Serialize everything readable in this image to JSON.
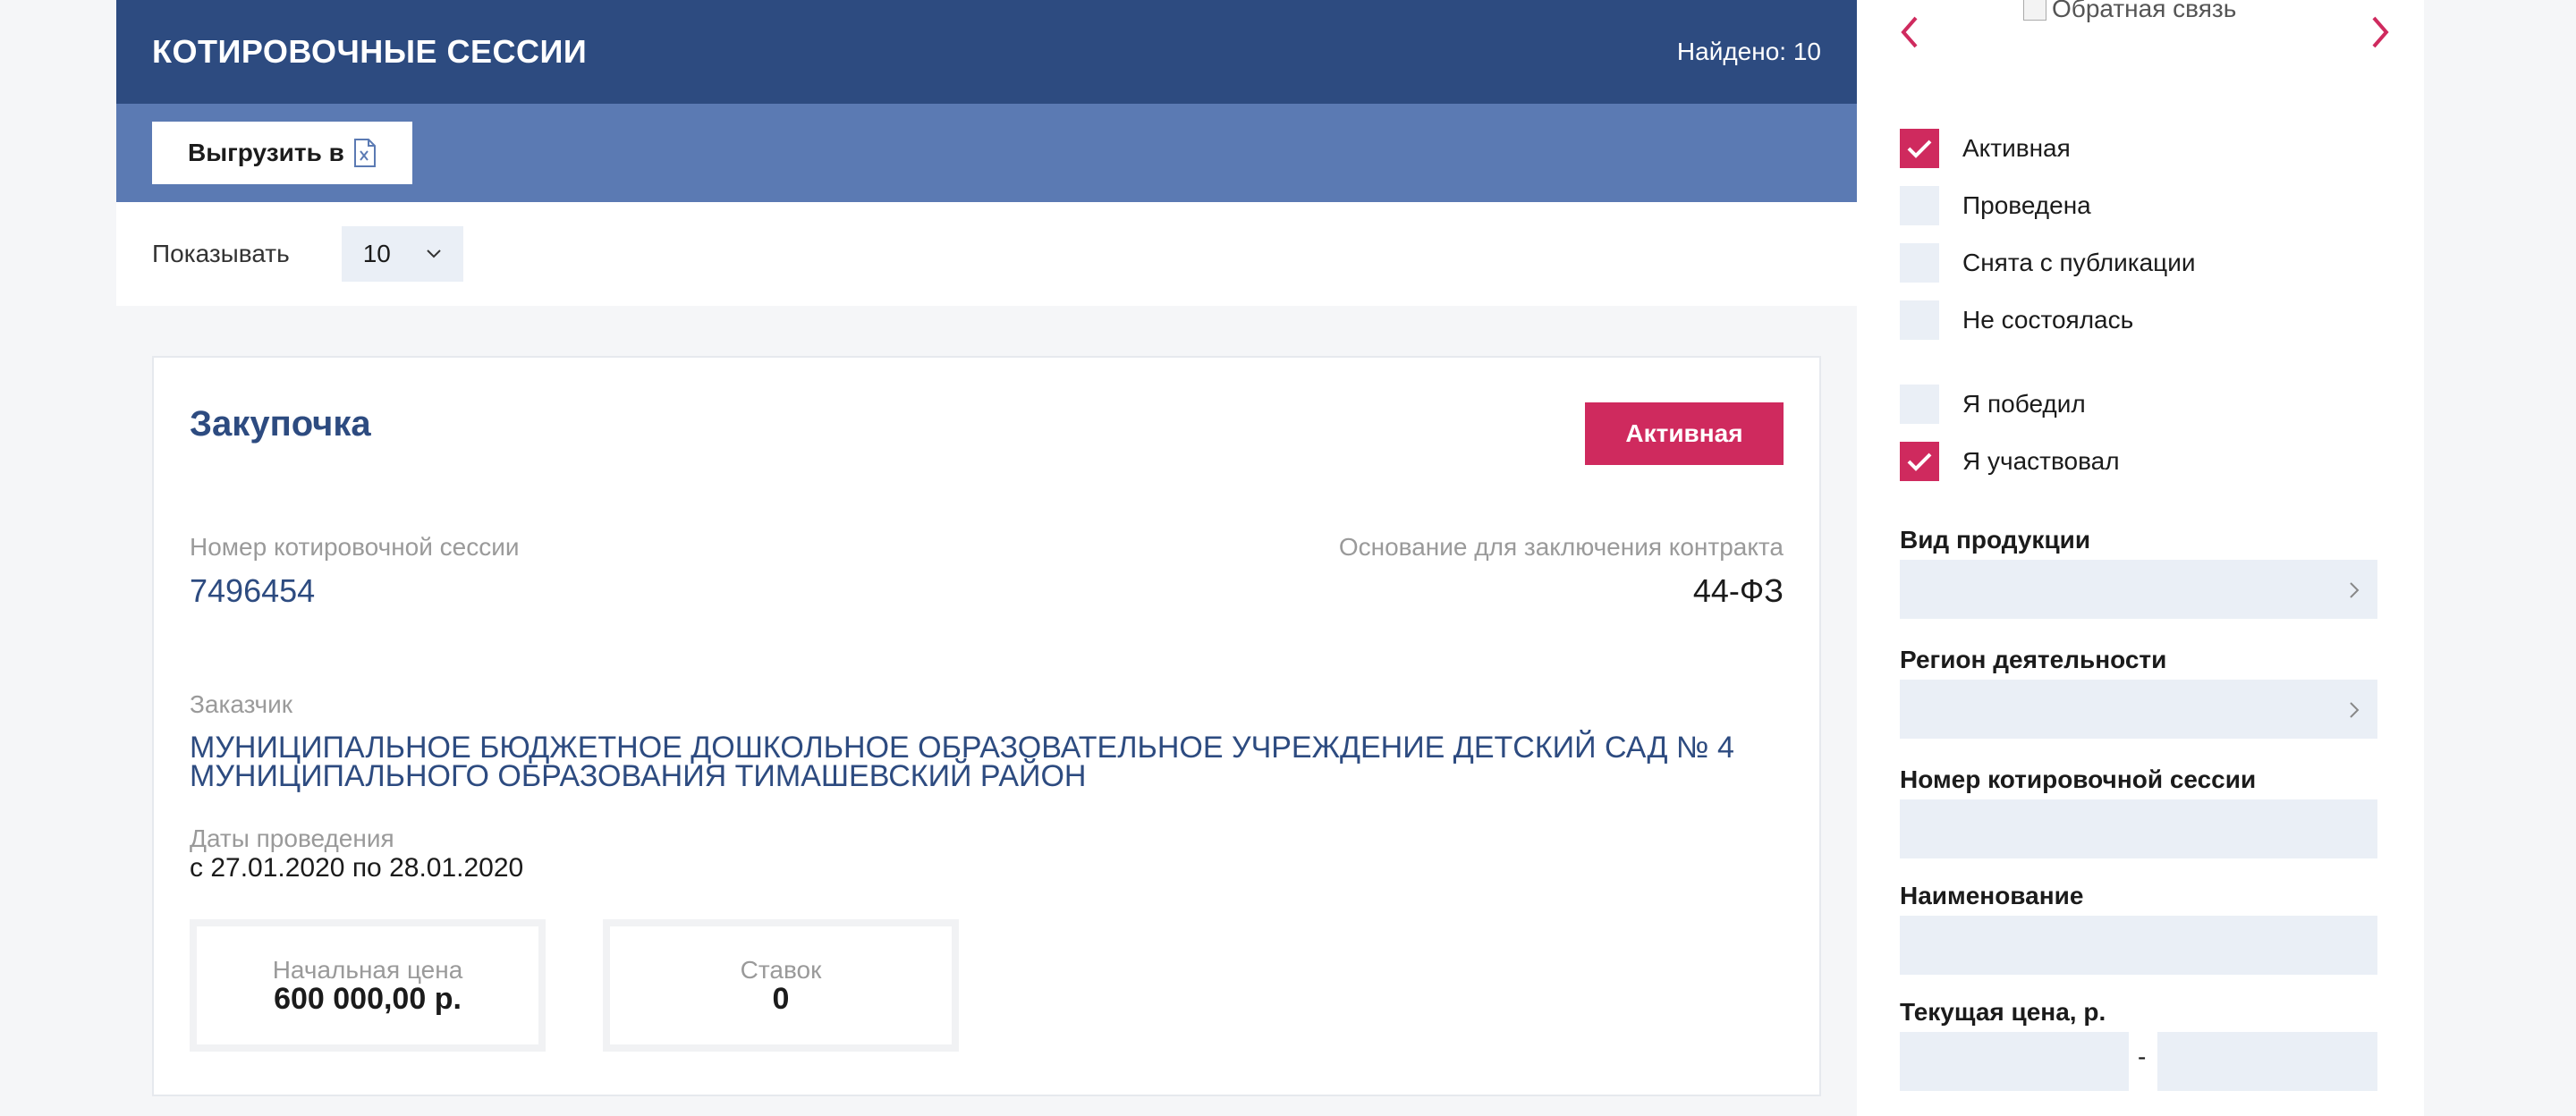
{
  "header": {
    "title": "КОТИРОВОЧНЫЕ СЕССИИ",
    "found": "Найдено: 10"
  },
  "toolbar": {
    "export_label": "Выгрузить в",
    "export_icon": "excel-file-icon"
  },
  "paging": {
    "show_label": "Показывать",
    "page_size": "10"
  },
  "card": {
    "title": "Закупочка",
    "status": "Активная",
    "session_number_label": "Номер котировочной сессии",
    "session_number": "7496454",
    "basis_label": "Основание для заключения контракта",
    "basis": "44-ФЗ",
    "customer_label": "Заказчик",
    "customer": "МУНИЦИПАЛЬНОЕ БЮДЖЕТНОЕ ДОШКОЛЬНОЕ ОБРАЗОВАТЕЛЬНОЕ УЧРЕЖДЕНИЕ ДЕТСКИЙ САД № 4 МУНИЦИПАЛЬНОГО ОБРАЗОВАНИЯ ТИМАШЕВСКИЙ РАЙОН",
    "dates_label": "Даты проведения",
    "dates": "с 27.01.2020 по 28.01.2020",
    "start_price_label": "Начальная цена",
    "start_price": "600 000,00 р.",
    "bids_label": "Ставок",
    "bids": "0"
  },
  "sidebar": {
    "banner_alt": "Обратная связь",
    "status_filters": [
      {
        "label": "Активная",
        "checked": true
      },
      {
        "label": "Проведена",
        "checked": false
      },
      {
        "label": "Снята с публикации",
        "checked": false
      },
      {
        "label": "Не состоялась",
        "checked": false
      }
    ],
    "participation_filters": [
      {
        "label": "Я победил",
        "checked": false
      },
      {
        "label": "Я участвовал",
        "checked": true
      }
    ],
    "product_type_label": "Вид продукции",
    "region_label": "Регион деятельности",
    "session_number_label": "Номер котировочной сессии",
    "name_label": "Наименование",
    "price_label": "Текущая цена, р.",
    "price_range_separator": "-"
  },
  "colors": {
    "header_bg": "#2d4b80",
    "toolbar_bg": "#5b7ab3",
    "accent": "#cf2a5e",
    "field_bg": "#eaeff6"
  }
}
